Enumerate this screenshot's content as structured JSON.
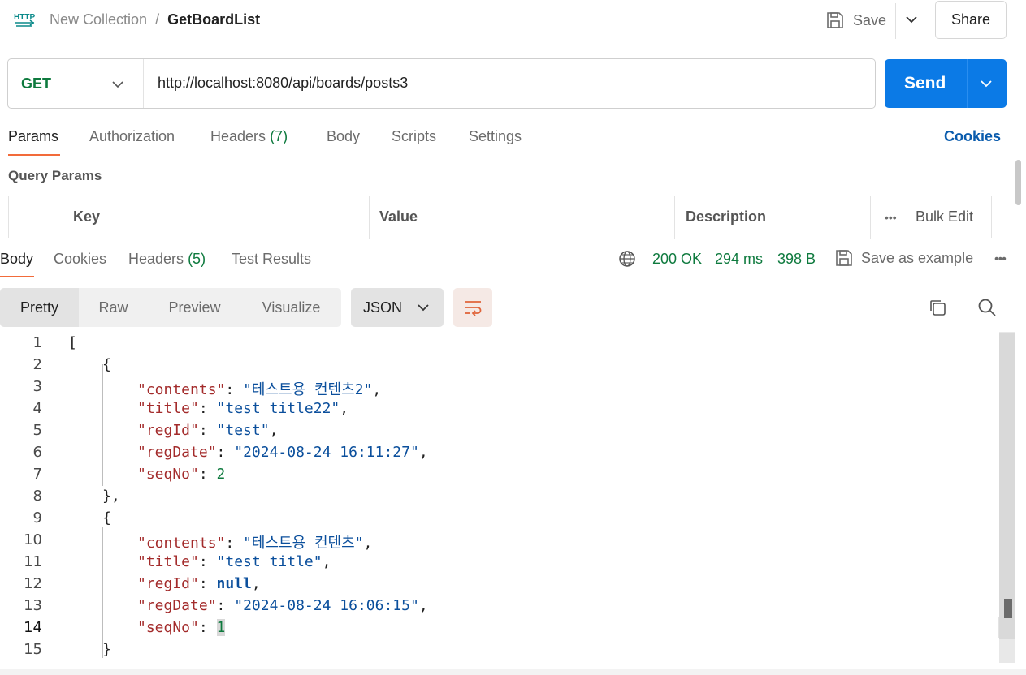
{
  "header": {
    "icon": "http-icon",
    "breadcrumb": {
      "collection": "New Collection",
      "separator": "/",
      "request": "GetBoardList"
    },
    "save_label": "Save",
    "share_label": "Share"
  },
  "request": {
    "method": "GET",
    "url": "http://localhost:8080/api/boards/posts3",
    "send_label": "Send",
    "method_color": "#0e7a3e",
    "send_color": "#0b7ae6"
  },
  "request_tabs": {
    "params": "Params",
    "authorization": "Authorization",
    "headers": "Headers",
    "headers_count": "(7)",
    "body": "Body",
    "scripts": "Scripts",
    "settings": "Settings",
    "cookies": "Cookies",
    "active": "Params"
  },
  "query_params": {
    "title": "Query Params",
    "columns": {
      "key": "Key",
      "value": "Value",
      "description": "Description"
    },
    "more": "•••",
    "bulk_edit": "Bulk Edit"
  },
  "response_tabs": {
    "body": "Body",
    "cookies": "Cookies",
    "headers": "Headers",
    "headers_count": "(5)",
    "test_results": "Test Results",
    "active": "Body"
  },
  "response_meta": {
    "status": "200 OK",
    "time": "294 ms",
    "size": "398 B",
    "save_example": "Save as example",
    "more": "•••"
  },
  "view_modes": {
    "pretty": "Pretty",
    "raw": "Raw",
    "preview": "Preview",
    "visualize": "Visualize",
    "active": "Pretty",
    "format": "JSON"
  },
  "code": {
    "lines": [
      {
        "num": "1"
      },
      {
        "num": "2"
      },
      {
        "num": "3",
        "key": "\"contents\"",
        "val": "\"테스트용 컨텐츠2\""
      },
      {
        "num": "4",
        "key": "\"title\"",
        "val": "\"test title22\""
      },
      {
        "num": "5",
        "key": "\"regId\"",
        "val": "\"test\""
      },
      {
        "num": "6",
        "key": "\"regDate\"",
        "val": "\"2024-08-24 16:11:27\""
      },
      {
        "num": "7",
        "key": "\"seqNo\"",
        "val": "2"
      },
      {
        "num": "8"
      },
      {
        "num": "9"
      },
      {
        "num": "10",
        "key": "\"contents\"",
        "val": "\"테스트용 컨텐츠\""
      },
      {
        "num": "11",
        "key": "\"title\"",
        "val": "\"test title\""
      },
      {
        "num": "12",
        "key": "\"regId\"",
        "val": "null"
      },
      {
        "num": "13",
        "key": "\"regDate\"",
        "val": "\"2024-08-24 16:06:15\""
      },
      {
        "num": "14",
        "key": "\"seqNo\"",
        "val": "1"
      },
      {
        "num": "15"
      }
    ],
    "brackets": {
      "open_array": "[",
      "open_obj": "{",
      "close_obj_comma": "},",
      "close_obj": "}"
    },
    "colon": ": ",
    "comma": ",",
    "current_line": "14"
  }
}
